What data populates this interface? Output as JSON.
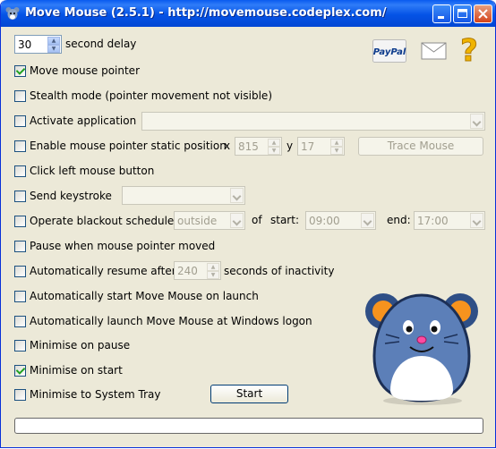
{
  "window": {
    "title": "Move Mouse (2.5.1) - http://movemouse.codeplex.com/"
  },
  "toolbar": {
    "paypal_label": "PayPal",
    "help_glyph": "?"
  },
  "delay": {
    "value": "30",
    "label": "second delay"
  },
  "options": {
    "move_pointer": {
      "label": "Move mouse pointer",
      "checked": true
    },
    "stealth": {
      "label": "Stealth mode (pointer movement not visible)",
      "checked": false
    },
    "activate_app": {
      "label": "Activate application",
      "checked": false,
      "selected": ""
    },
    "static_position": {
      "label": "Enable mouse pointer static position",
      "checked": false,
      "x_label": "x",
      "x_value": "815",
      "y_label": "y",
      "y_value": "17",
      "trace_button": "Trace Mouse"
    },
    "click_left": {
      "label": "Click left mouse button",
      "checked": false
    },
    "send_keystroke": {
      "label": "Send keystroke",
      "checked": false,
      "selected": ""
    },
    "blackout": {
      "label": "Operate blackout schedule",
      "checked": false,
      "mode": "outside",
      "of_label": "of",
      "start_label": "start:",
      "start_value": "09:00",
      "end_label": "end:",
      "end_value": "17:00"
    },
    "pause_moved": {
      "label": "Pause when mouse pointer moved",
      "checked": false
    },
    "auto_resume": {
      "label": "Automatically resume after",
      "checked": false,
      "value": "240",
      "suffix": "seconds of inactivity"
    },
    "auto_start": {
      "label": "Automatically start Move Mouse on launch",
      "checked": false
    },
    "auto_launch": {
      "label": "Automatically launch Move Mouse at Windows logon",
      "checked": false
    },
    "min_pause": {
      "label": "Minimise on pause",
      "checked": false
    },
    "min_start": {
      "label": "Minimise on start",
      "checked": true
    },
    "min_tray": {
      "label": "Minimise to System Tray",
      "checked": false
    }
  },
  "start_button": {
    "label": "Start"
  },
  "progress": {
    "fraction": 0
  },
  "colors": {
    "title_bar": "#0a5bef",
    "face": "#ece9d8",
    "mouse_body": "#5c7fb8",
    "mouse_ear": "#ff8c2a"
  },
  "icons": [
    "app-mouse-icon",
    "minimize-icon",
    "maximize-icon",
    "close-icon",
    "paypal-icon",
    "envelope-icon",
    "help-icon",
    "mascot-mouse"
  ]
}
